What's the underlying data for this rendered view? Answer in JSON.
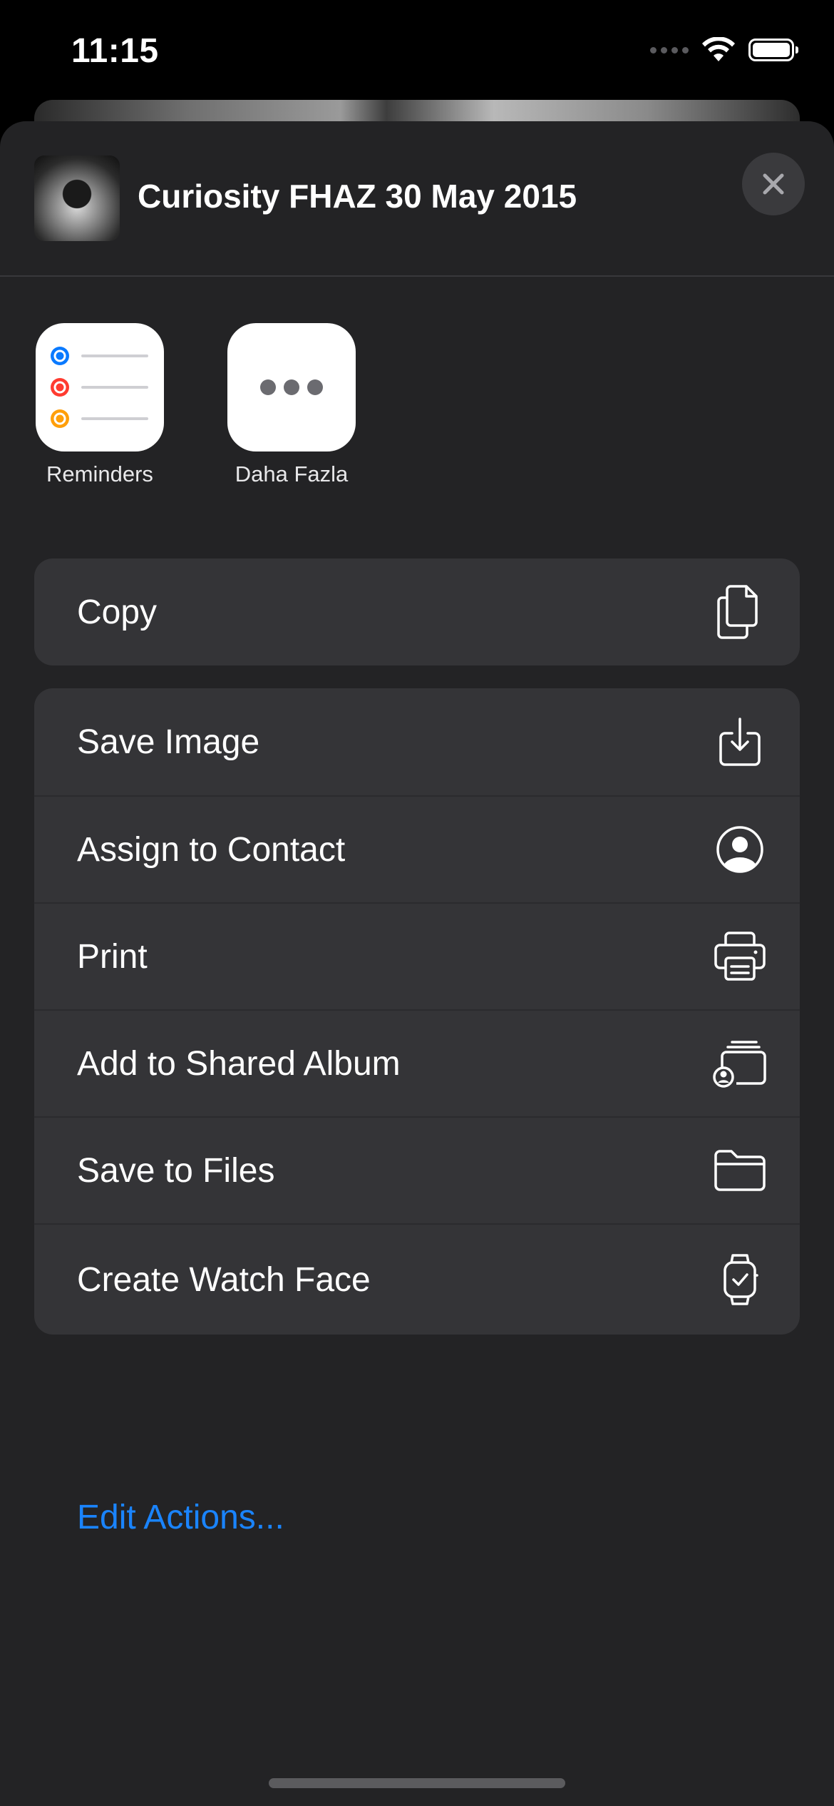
{
  "status_bar": {
    "time": "11:15"
  },
  "share_sheet": {
    "title": "Curiosity FHAZ 30 May 2015",
    "close_icon": "close-icon"
  },
  "apps": [
    {
      "label": "Reminders",
      "icon": "reminders-icon"
    },
    {
      "label": "Daha Fazla",
      "icon": "more-icon"
    }
  ],
  "actions_primary": [
    {
      "label": "Copy",
      "icon": "copy-icon"
    }
  ],
  "actions_secondary": [
    {
      "label": "Save Image",
      "icon": "save-image-icon"
    },
    {
      "label": "Assign to Contact",
      "icon": "contact-icon"
    },
    {
      "label": "Print",
      "icon": "printer-icon"
    },
    {
      "label": "Add to Shared Album",
      "icon": "shared-album-icon"
    },
    {
      "label": "Save to Files",
      "icon": "folder-icon"
    },
    {
      "label": "Create Watch Face",
      "icon": "watch-icon"
    }
  ],
  "edit_actions": "Edit Actions...",
  "colors": {
    "accent": "#1a84ff",
    "sheet_bg": "#232325",
    "group_bg": "#343437",
    "reminder_blue": "#0a7aff",
    "reminder_red": "#ff3b30",
    "reminder_orange": "#ff9f0a"
  }
}
